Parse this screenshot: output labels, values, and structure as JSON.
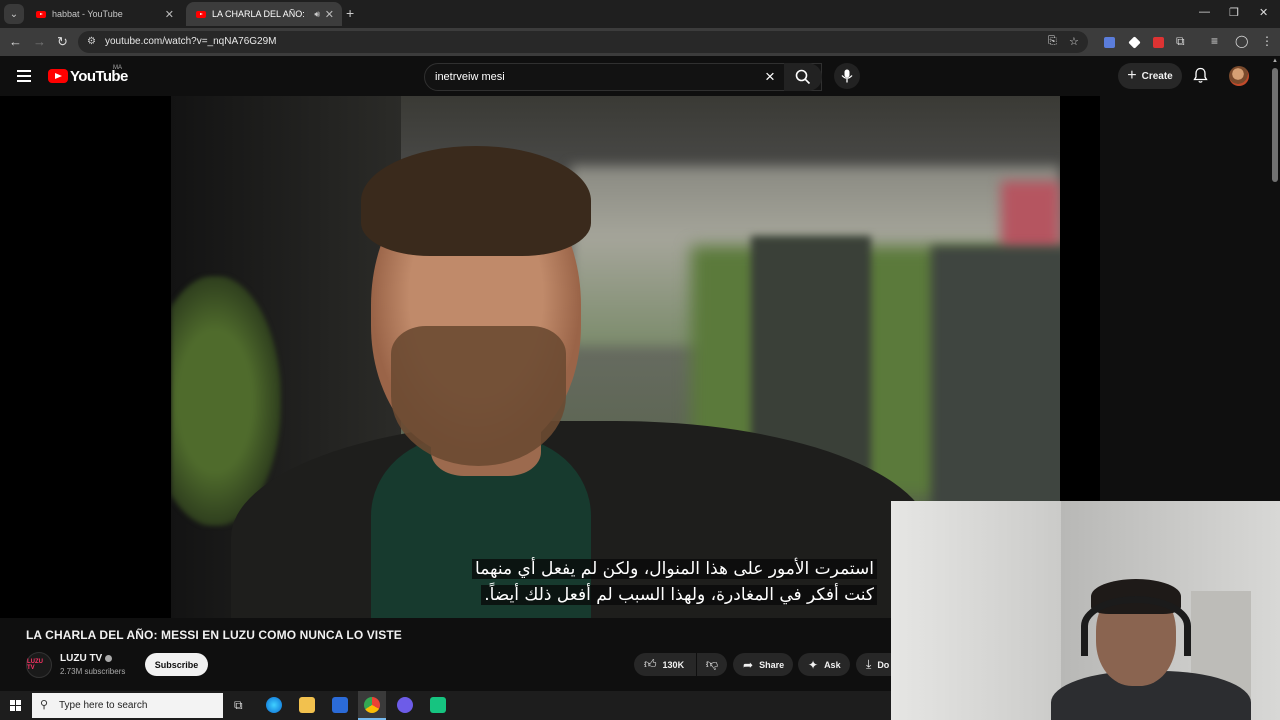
{
  "browser": {
    "tabs": [
      {
        "title": "habbat - YouTube",
        "active": false
      },
      {
        "title": "LA CHARLA DEL AÑO: MESI",
        "active": true
      }
    ],
    "url": "youtube.com/watch?v=_nqNA76G29M"
  },
  "youtube": {
    "logo_text": "YouTube",
    "country_code": "MA",
    "search_value": "inetrveiw mesi",
    "create_label": "Create"
  },
  "video": {
    "subtitle_lines": [
      "استمرت الأمور على هذا المنوال، ولكن لم يفعل أي منهما",
      "كنت أفكر في المغادرة، ولهذا السبب لم أفعل ذلك أيضاً."
    ],
    "title": "LA CHARLA DEL AÑO: MESSI EN LUZU COMO NUNCA LO VISTE"
  },
  "channel": {
    "name": "LUZU TV",
    "subscribers": "2.73M subscribers",
    "avatar_text": "LUZU TV",
    "subscribe_label": "Subscribe"
  },
  "actions": {
    "likes": "130K",
    "share": "Share",
    "ask": "Ask",
    "download": "Do"
  },
  "taskbar": {
    "search_placeholder": "Type here to search"
  },
  "colors": {
    "youtube_red": "#ff0000",
    "background": "#0f0f0f",
    "taskbar_accent": "#76b9ed"
  }
}
